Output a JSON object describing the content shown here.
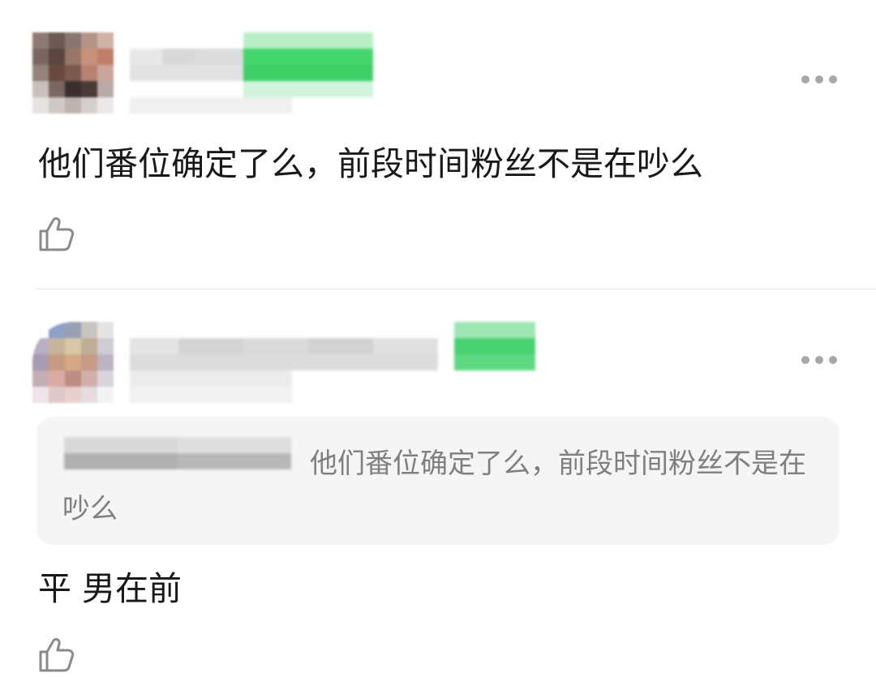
{
  "comments": [
    {
      "text": "他们番位确定了么，前段时间粉丝不是在吵么",
      "more_icon": "more-dots-icon",
      "like_icon": "thumbs-up-icon"
    },
    {
      "quoted": {
        "text": "他们番位确定了么，前段时间粉丝不是在吵么"
      },
      "text": "平 男在前",
      "more_icon": "more-dots-icon",
      "like_icon": "thumbs-up-icon"
    }
  ],
  "colors": {
    "text_primary": "#191919",
    "text_secondary": "#7f7f7f",
    "quote_background": "#f5f5f5",
    "badge_green": "#3dd16a",
    "icon_gray": "#a8a8a8"
  }
}
